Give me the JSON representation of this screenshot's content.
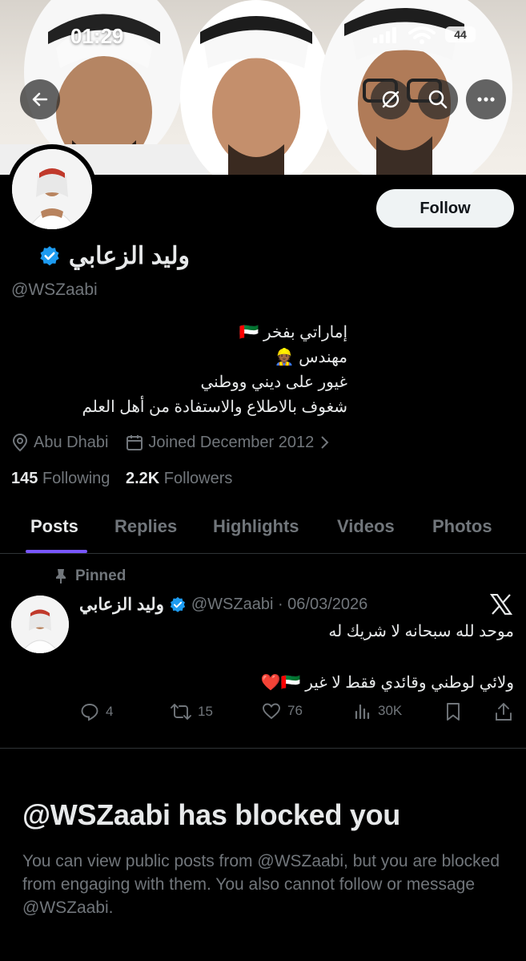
{
  "status_bar": {
    "time": "01:29",
    "battery": "44"
  },
  "header": {
    "back_icon": "back-arrow-icon",
    "actions": [
      "grok-icon",
      "search-icon",
      "more-icon"
    ]
  },
  "profile": {
    "display_name": "وليد الزعابي",
    "handle": "@WSZaabi",
    "verified": true,
    "follow_label": "Follow",
    "bio": [
      "إماراتي بفخر 🇦🇪",
      "مهندس 👷🏾",
      "غيور على ديني ووطني",
      "شغوف بالاطلاع والاستفادة من أهل العلم"
    ],
    "location": "Abu Dhabi",
    "joined": "Joined December 2012",
    "following_count": "145",
    "following_label": "Following",
    "followers_count": "2.2K",
    "followers_label": "Followers"
  },
  "tabs": [
    "Posts",
    "Replies",
    "Highlights",
    "Videos",
    "Photos"
  ],
  "active_tab": "Posts",
  "pinned_post": {
    "pinned_label": "Pinned",
    "author": "وليد الزعابي",
    "handle_date": "@WSZaabi · 06/03/2026",
    "lines": [
      "موحد لله سبحانه لا شريك له",
      "",
      "ولائي لوطني وقائدي فقط لا غير 🇦🇪❤️"
    ],
    "replies": "4",
    "reposts": "15",
    "likes": "76",
    "views": "30K"
  },
  "blocked": {
    "title": "@WSZaabi has blocked you",
    "message": "You can view public posts from @WSZaabi, but you are blocked from engaging with them. You also cannot follow or message @WSZaabi."
  },
  "colors": {
    "accent": "#7856ff",
    "verified": "#1d9bf0",
    "muted": "#71767b"
  }
}
